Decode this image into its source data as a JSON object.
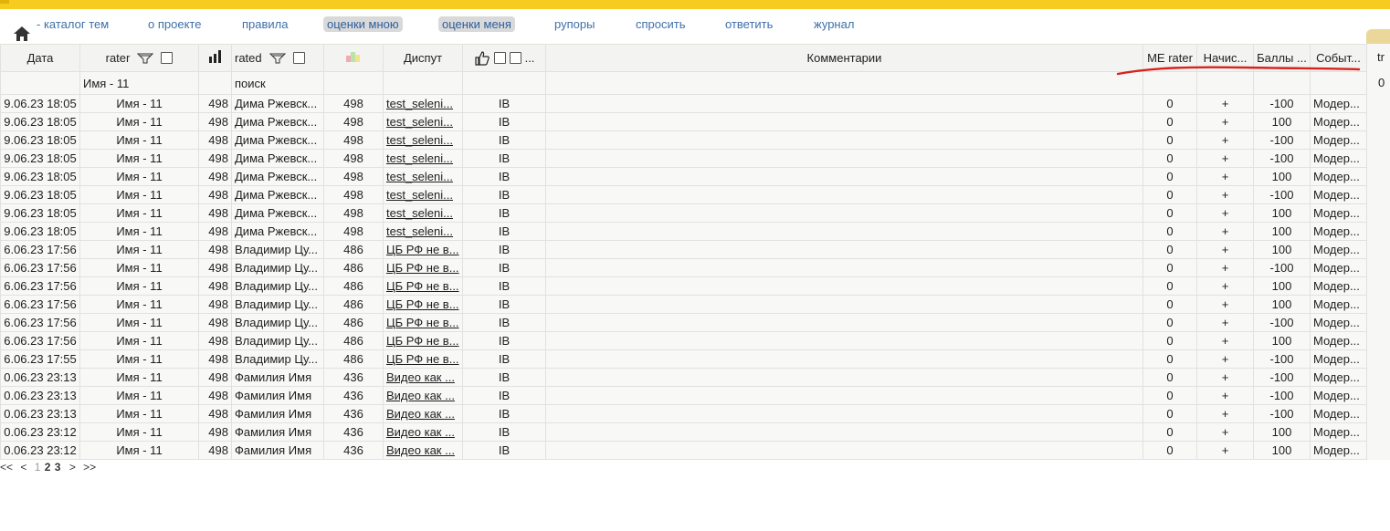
{
  "nav": {
    "catalog": "- каталог тем",
    "about": "о проекте",
    "rules": "правила",
    "rated_by_me": "оценки мною",
    "rated_me": "оценки меня",
    "speakers": "рупоры",
    "ask": "спросить",
    "answer": "ответить",
    "journal": "журнал"
  },
  "headers": {
    "date": "Дата",
    "rater": "rater",
    "rated": "rated",
    "dispute": "Диспут",
    "more": "...",
    "comments": "Комментарии",
    "me_rater": "ME rater",
    "nachis": "Начис...",
    "bally": "Баллы ...",
    "sobyt": "Событ...",
    "tr": "tr"
  },
  "filter": {
    "rater_value": "Имя - 11",
    "rated_placeholder": "поиск",
    "right_zero": "0"
  },
  "rows": [
    {
      "date": "9.06.23 18:05",
      "rater": "Имя - 11",
      "n1": "498",
      "rated": "Дима Ржевск...",
      "n2": "498",
      "dispute": "test_seleni...",
      "ib": "IB",
      "comment": "",
      "me": "0",
      "plus": "+",
      "score": "-100",
      "event": "Модер..."
    },
    {
      "date": "9.06.23 18:05",
      "rater": "Имя - 11",
      "n1": "498",
      "rated": "Дима Ржевск...",
      "n2": "498",
      "dispute": "test_seleni...",
      "ib": "IB",
      "comment": "",
      "me": "0",
      "plus": "+",
      "score": "100",
      "event": "Модер..."
    },
    {
      "date": "9.06.23 18:05",
      "rater": "Имя - 11",
      "n1": "498",
      "rated": "Дима Ржевск...",
      "n2": "498",
      "dispute": "test_seleni...",
      "ib": "IB",
      "comment": "",
      "me": "0",
      "plus": "+",
      "score": "-100",
      "event": "Модер..."
    },
    {
      "date": "9.06.23 18:05",
      "rater": "Имя - 11",
      "n1": "498",
      "rated": "Дима Ржевск...",
      "n2": "498",
      "dispute": "test_seleni...",
      "ib": "IB",
      "comment": "",
      "me": "0",
      "plus": "+",
      "score": "-100",
      "event": "Модер..."
    },
    {
      "date": "9.06.23 18:05",
      "rater": "Имя - 11",
      "n1": "498",
      "rated": "Дима Ржевск...",
      "n2": "498",
      "dispute": "test_seleni...",
      "ib": "IB",
      "comment": "",
      "me": "0",
      "plus": "+",
      "score": "100",
      "event": "Модер..."
    },
    {
      "date": "9.06.23 18:05",
      "rater": "Имя - 11",
      "n1": "498",
      "rated": "Дима Ржевск...",
      "n2": "498",
      "dispute": "test_seleni...",
      "ib": "IB",
      "comment": "",
      "me": "0",
      "plus": "+",
      "score": "-100",
      "event": "Модер..."
    },
    {
      "date": "9.06.23 18:05",
      "rater": "Имя - 11",
      "n1": "498",
      "rated": "Дима Ржевск...",
      "n2": "498",
      "dispute": "test_seleni...",
      "ib": "IB",
      "comment": "",
      "me": "0",
      "plus": "+",
      "score": "100",
      "event": "Модер..."
    },
    {
      "date": "9.06.23 18:05",
      "rater": "Имя - 11",
      "n1": "498",
      "rated": "Дима Ржевск...",
      "n2": "498",
      "dispute": "test_seleni...",
      "ib": "IB",
      "comment": "",
      "me": "0",
      "plus": "+",
      "score": "100",
      "event": "Модер..."
    },
    {
      "date": "6.06.23 17:56",
      "rater": "Имя - 11",
      "n1": "498",
      "rated": "Владимир Цу...",
      "n2": "486",
      "dispute": "ЦБ РФ не в...",
      "ib": "IB",
      "comment": "",
      "me": "0",
      "plus": "+",
      "score": "100",
      "event": "Модер..."
    },
    {
      "date": "6.06.23 17:56",
      "rater": "Имя - 11",
      "n1": "498",
      "rated": "Владимир Цу...",
      "n2": "486",
      "dispute": "ЦБ РФ не в...",
      "ib": "IB",
      "comment": "",
      "me": "0",
      "plus": "+",
      "score": "-100",
      "event": "Модер..."
    },
    {
      "date": "6.06.23 17:56",
      "rater": "Имя - 11",
      "n1": "498",
      "rated": "Владимир Цу...",
      "n2": "486",
      "dispute": "ЦБ РФ не в...",
      "ib": "IB",
      "comment": "",
      "me": "0",
      "plus": "+",
      "score": "100",
      "event": "Модер..."
    },
    {
      "date": "6.06.23 17:56",
      "rater": "Имя - 11",
      "n1": "498",
      "rated": "Владимир Цу...",
      "n2": "486",
      "dispute": "ЦБ РФ не в...",
      "ib": "IB",
      "comment": "",
      "me": "0",
      "plus": "+",
      "score": "100",
      "event": "Модер..."
    },
    {
      "date": "6.06.23 17:56",
      "rater": "Имя - 11",
      "n1": "498",
      "rated": "Владимир Цу...",
      "n2": "486",
      "dispute": "ЦБ РФ не в...",
      "ib": "IB",
      "comment": "",
      "me": "0",
      "plus": "+",
      "score": "-100",
      "event": "Модер..."
    },
    {
      "date": "6.06.23 17:56",
      "rater": "Имя - 11",
      "n1": "498",
      "rated": "Владимир Цу...",
      "n2": "486",
      "dispute": "ЦБ РФ не в...",
      "ib": "IB",
      "comment": "",
      "me": "0",
      "plus": "+",
      "score": "100",
      "event": "Модер..."
    },
    {
      "date": "6.06.23 17:55",
      "rater": "Имя - 11",
      "n1": "498",
      "rated": "Владимир Цу...",
      "n2": "486",
      "dispute": "ЦБ РФ не в...",
      "ib": "IB",
      "comment": "",
      "me": "0",
      "plus": "+",
      "score": "-100",
      "event": "Модер..."
    },
    {
      "date": "0.06.23 23:13",
      "rater": "Имя - 11",
      "n1": "498",
      "rated": "Фамилия Имя",
      "n2": "436",
      "dispute": "Видео как ...",
      "ib": "IB",
      "comment": "",
      "me": "0",
      "plus": "+",
      "score": "-100",
      "event": "Модер..."
    },
    {
      "date": "0.06.23 23:13",
      "rater": "Имя - 11",
      "n1": "498",
      "rated": "Фамилия Имя",
      "n2": "436",
      "dispute": "Видео как ...",
      "ib": "IB",
      "comment": "",
      "me": "0",
      "plus": "+",
      "score": "-100",
      "event": "Модер..."
    },
    {
      "date": "0.06.23 23:13",
      "rater": "Имя - 11",
      "n1": "498",
      "rated": "Фамилия Имя",
      "n2": "436",
      "dispute": "Видео как ...",
      "ib": "IB",
      "comment": "",
      "me": "0",
      "plus": "+",
      "score": "-100",
      "event": "Модер..."
    },
    {
      "date": "0.06.23 23:12",
      "rater": "Имя - 11",
      "n1": "498",
      "rated": "Фамилия Имя",
      "n2": "436",
      "dispute": "Видео как ...",
      "ib": "IB",
      "comment": "",
      "me": "0",
      "plus": "+",
      "score": "100",
      "event": "Модер..."
    },
    {
      "date": "0.06.23 23:12",
      "rater": "Имя - 11",
      "n1": "498",
      "rated": "Фамилия Имя",
      "n2": "436",
      "dispute": "Видео как ...",
      "ib": "IB",
      "comment": "",
      "me": "0",
      "plus": "+",
      "score": "100",
      "event": "Модер..."
    }
  ],
  "pager": {
    "first": "<<",
    "prev": "<",
    "p1": "1",
    "p2": "2",
    "p3": "3",
    "next": ">",
    "last": ">>"
  },
  "colors": {
    "topbar": "#f6cd1e",
    "link": "#2f6fbf",
    "annotation": "#d6231e"
  },
  "icons": [
    "home-icon",
    "filter-funnel-icon",
    "bar-chart-icon",
    "color-blocks-icon",
    "thumbs-up-icon"
  ]
}
